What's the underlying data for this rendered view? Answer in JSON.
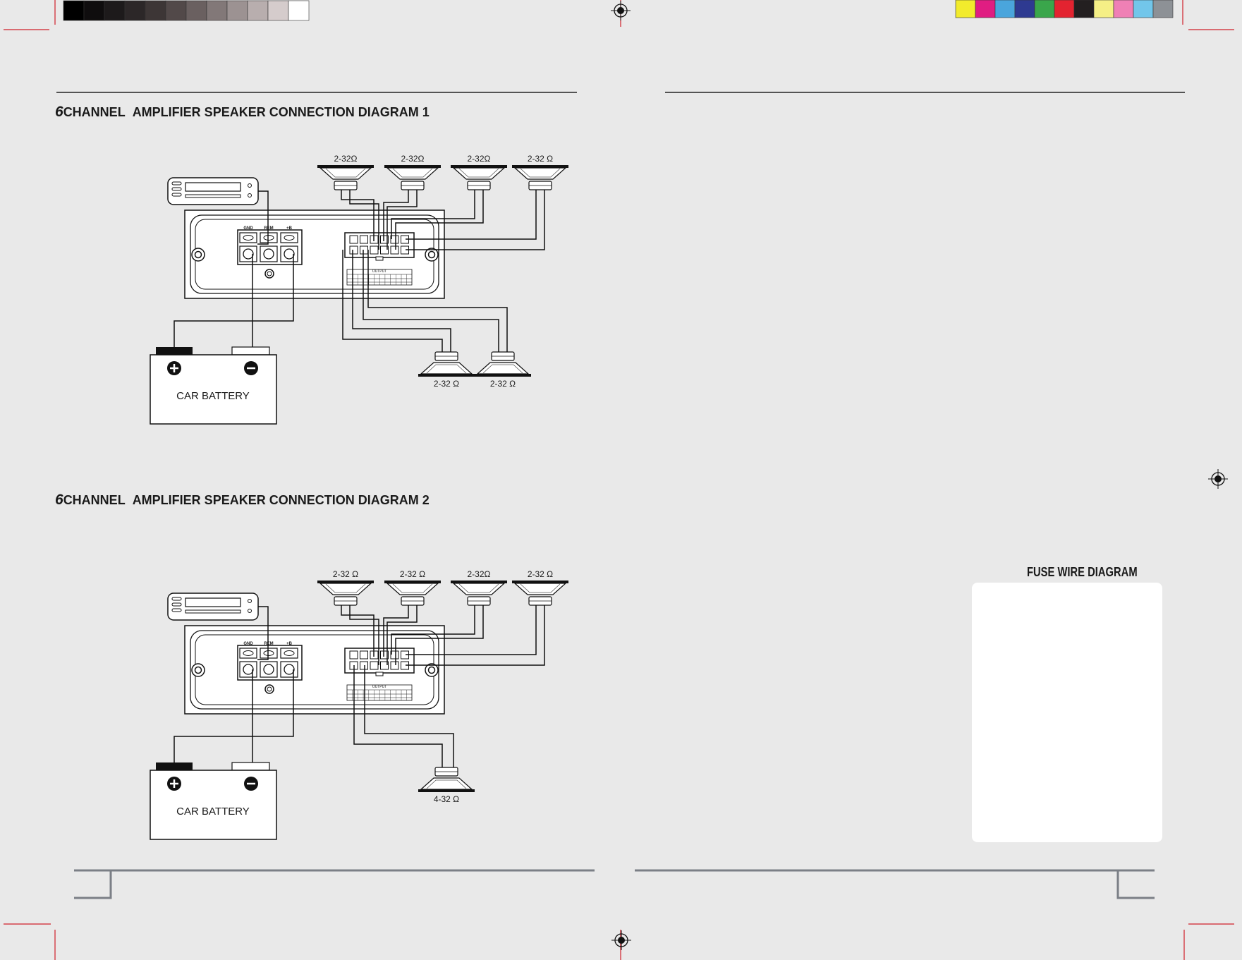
{
  "color_bar_left": [
    "#000000",
    "#0f0d0e",
    "#1d1a1b",
    "#2c2728",
    "#3d3636",
    "#524949",
    "#6a6060",
    "#827878",
    "#9c9292",
    "#b8aeae",
    "#d5cccc",
    "#ffffff"
  ],
  "color_bar_right": [
    "#f2eb2c",
    "#e01d82",
    "#4aa5dc",
    "#2e3a91",
    "#3aa64b",
    "#e32330",
    "#231f20",
    "#f5ef86",
    "#ef80b5",
    "#72c6ea",
    "#8d9196"
  ],
  "diagram1": {
    "title_num": "6",
    "title_channel": "CHANNEL",
    "title_rest": "AMPLIFIER SPEAKER CONNECTION DIAGRAM 1",
    "speaker_labels_top": [
      "2-32Ω",
      "2-32Ω",
      "2-32Ω",
      "2-32 Ω"
    ],
    "speaker_labels_bottom": [
      "2-32 Ω",
      "2-32 Ω"
    ],
    "terminals": [
      "GND",
      "REM",
      "+B"
    ],
    "output_label": "OUTPUT",
    "battery_label": "CAR BATTERY"
  },
  "diagram2": {
    "title_num": "6",
    "title_channel": "CHANNEL",
    "title_rest": "AMPLIFIER SPEAKER CONNECTION DIAGRAM 2",
    "speaker_labels_top": [
      "2-32 Ω",
      "2-32 Ω",
      "2-32Ω",
      "2-32 Ω"
    ],
    "speaker_labels_bottom": [
      "4-32 Ω"
    ],
    "terminals": [
      "GND",
      "REM",
      "+B"
    ],
    "output_label": "OUTPUT",
    "battery_label": "CAR BATTERY"
  },
  "fuse_title": "FUSE WIRE DIAGRAM"
}
